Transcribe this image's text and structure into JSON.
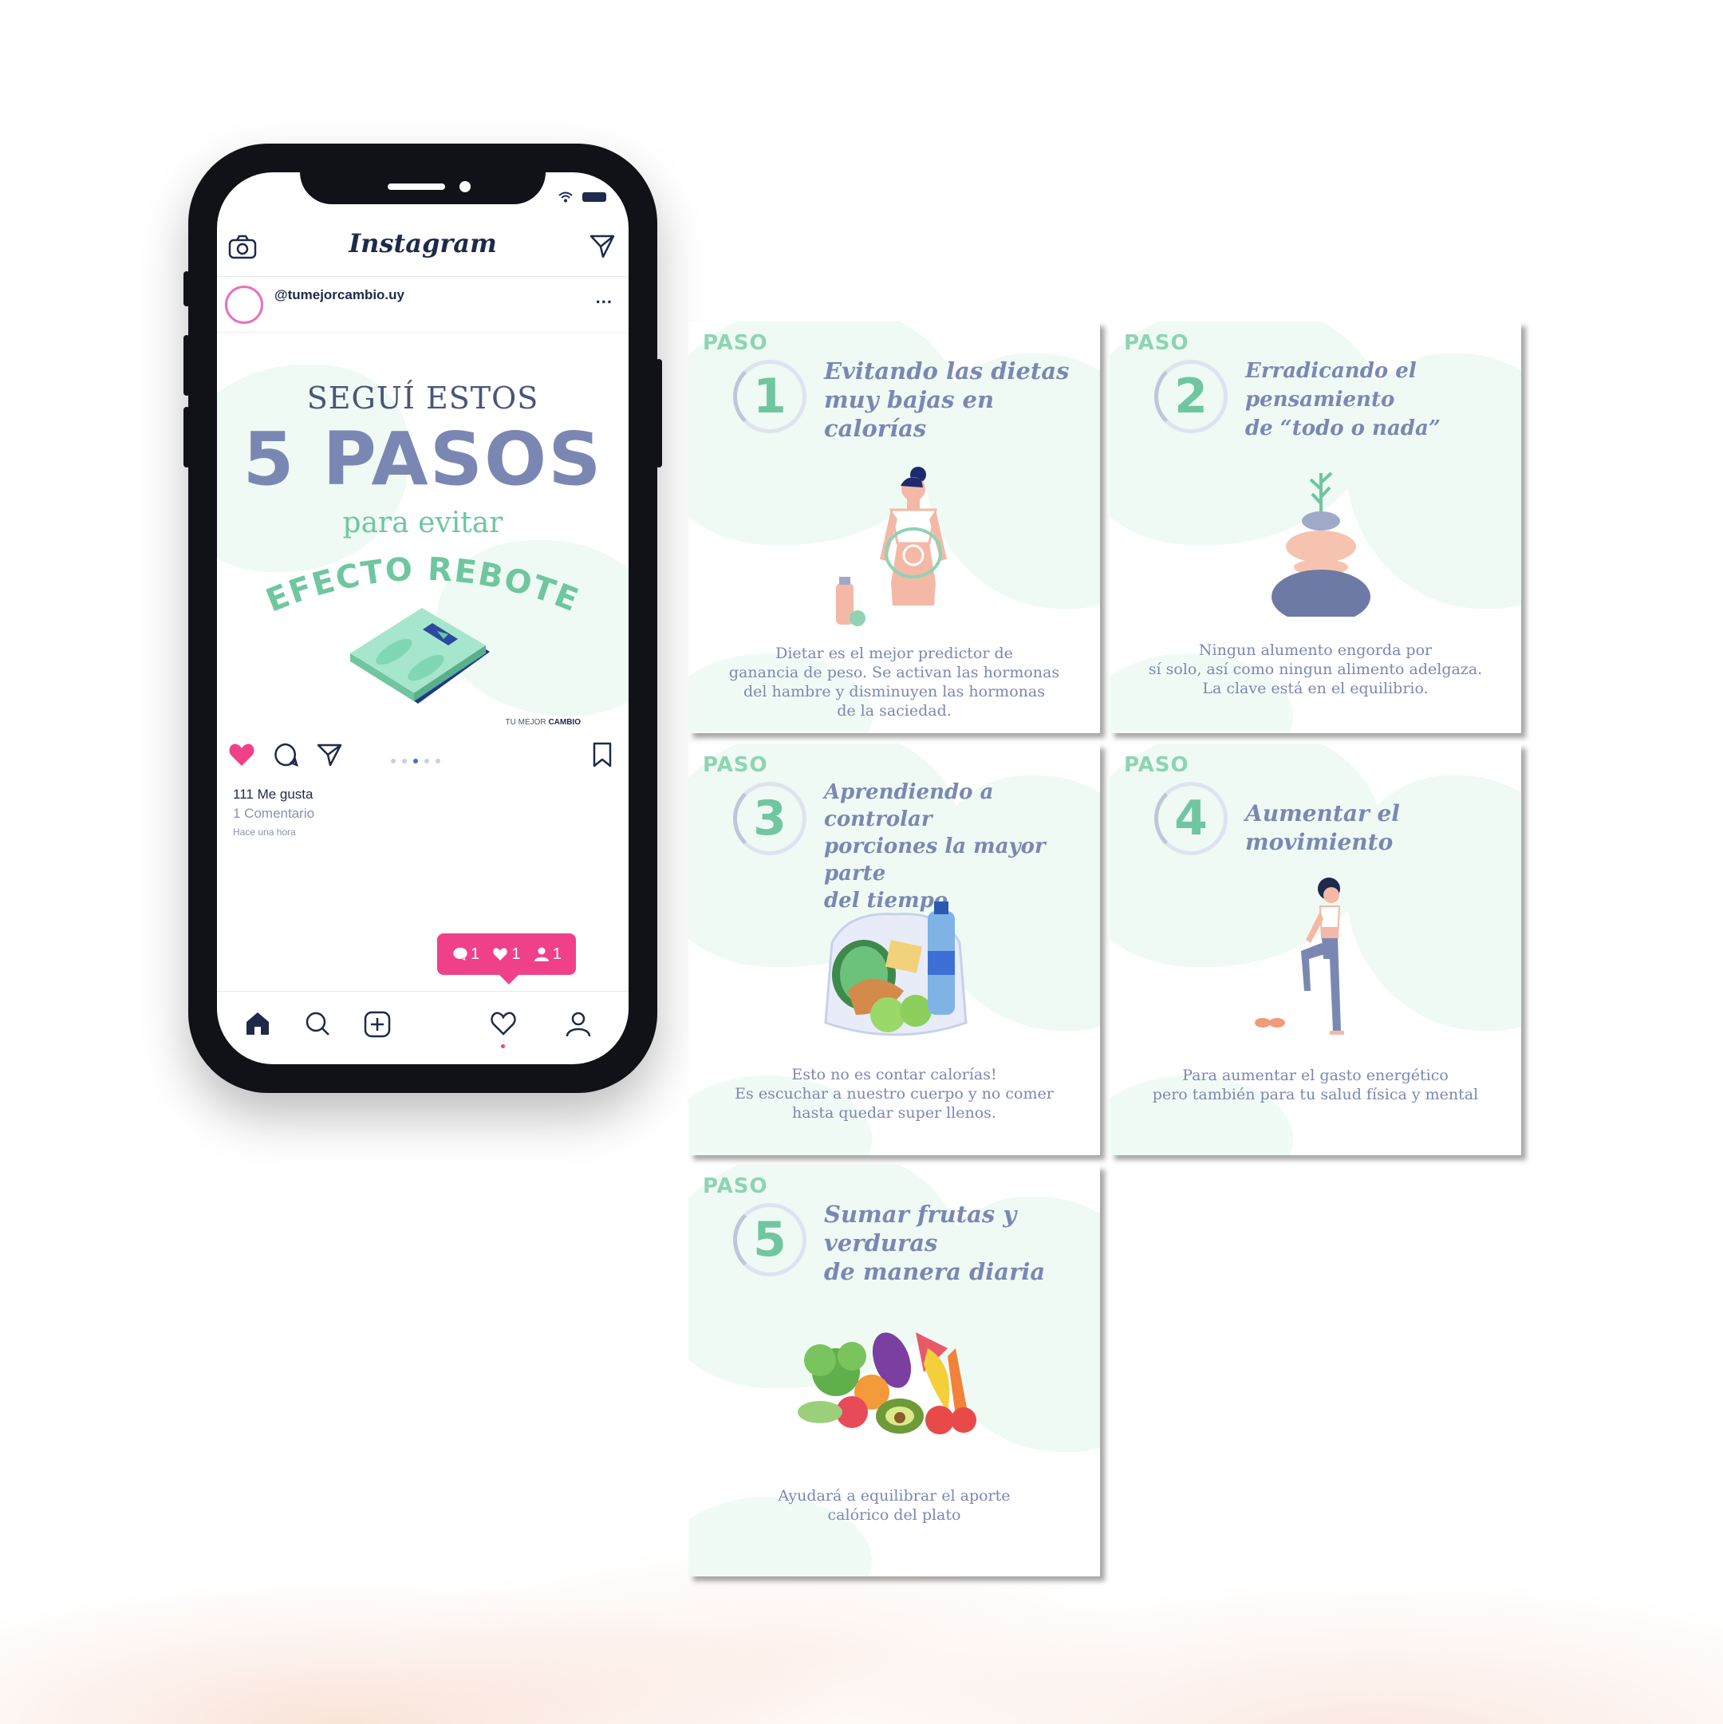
{
  "instagram": {
    "logo": "Instagram",
    "username": "@tumejorcambio.uy",
    "more": "...",
    "post": {
      "line1": "SEGUÍ ESTOS",
      "line2": "5 PASOS",
      "line3": "para evitar",
      "line4": "EFECTO REBOTE",
      "brand_light": "TU MEJOR ",
      "brand_bold": "CAMBIO"
    },
    "likes": "111 Me gusta",
    "comments": "1 Comentario",
    "time_ago": "Hace una hora",
    "notification": {
      "comments": "1",
      "likes": "1",
      "followers": "1"
    },
    "carousel": {
      "count": 5,
      "active": 2
    }
  },
  "cards": [
    {
      "paso": "PASO",
      "number": "1",
      "title_lines": [
        "Evitando las dietas",
        "muy bajas en calorías"
      ],
      "desc_lines": [
        "Dietar es el mejor predictor de",
        "ganancia de peso. Se activan las hormonas",
        "del hambre y disminuyen las hormonas",
        "de la saciedad."
      ]
    },
    {
      "paso": "PASO",
      "number": "2",
      "title_lines": [
        "Erradicando el pensamiento",
        "de “todo o nada”"
      ],
      "desc_lines": [
        "Ningun alumento engorda por",
        "sí solo, así como ningun alimento adelgaza.",
        "La clave está en el equilibrio."
      ]
    },
    {
      "paso": "PASO",
      "number": "3",
      "title_lines": [
        "Aprendiendo a controlar",
        "porciones la mayor parte",
        "del tiempo"
      ],
      "desc_lines": [
        "Esto no es contar calorías!",
        "Es escuchar a nuestro cuerpo y no comer",
        "hasta quedar super llenos."
      ]
    },
    {
      "paso": "PASO",
      "number": "4",
      "title_lines": [
        "Aumentar el movimiento"
      ],
      "desc_lines": [
        "Para aumentar el gasto energético",
        "pero también para tu salud física y mental"
      ]
    },
    {
      "paso": "PASO",
      "number": "5",
      "title_lines": [
        "Sumar frutas y verduras",
        "de manera diaria"
      ],
      "desc_lines": [
        "Ayudará a equilibrar el aporte",
        "calórico del plato"
      ]
    }
  ],
  "colors": {
    "navy": "#1e2a4a",
    "lavender": "#7b87b3",
    "mint": "#6fc6a0",
    "mint_light": "#eefaf3",
    "pink": "#f0408a"
  }
}
